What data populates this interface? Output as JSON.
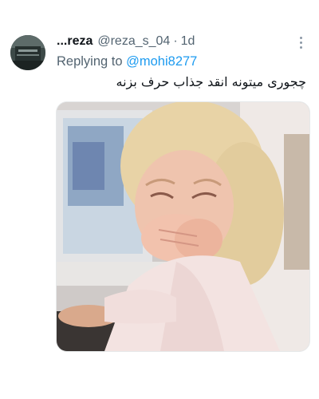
{
  "tweet": {
    "display_name": "...reza",
    "handle": "@reza_s_04",
    "separator": "·",
    "time": "1d",
    "replying_prefix": "Replying to ",
    "replying_to": "@mohi8277",
    "text": "چجوری میتونه انقد جذاب حرف بزنه"
  },
  "icons": {
    "more": "more-vertical-icon"
  },
  "colors": {
    "link": "#1d9bf0",
    "secondary_text": "#536471",
    "primary_text": "#0f1419"
  }
}
